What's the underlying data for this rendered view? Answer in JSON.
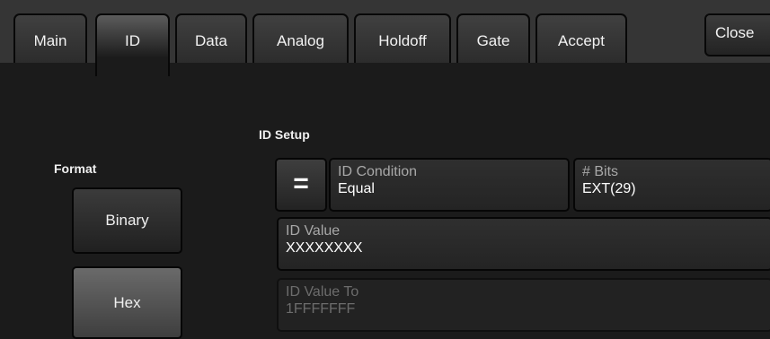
{
  "tabs": [
    {
      "label": "Main"
    },
    {
      "label": "ID"
    },
    {
      "label": "Data"
    },
    {
      "label": "Analog"
    },
    {
      "label": "Holdoff"
    },
    {
      "label": "Gate"
    },
    {
      "label": "Accept"
    }
  ],
  "active_tab": "ID",
  "close_label": "Close",
  "format": {
    "title": "Format",
    "binary_label": "Binary",
    "hex_label": "Hex",
    "selected": "Hex"
  },
  "id_setup": {
    "title": "ID Setup",
    "operator_symbol": "=",
    "condition": {
      "caption": "ID Condition",
      "value": "Equal"
    },
    "bits": {
      "caption": "# Bits",
      "value": "EXT(29)"
    },
    "id_value": {
      "caption": "ID Value",
      "value": "XXXXXXXX"
    },
    "id_value_to": {
      "caption": "ID Value To",
      "value": "1FFFFFFF",
      "enabled": false
    }
  }
}
